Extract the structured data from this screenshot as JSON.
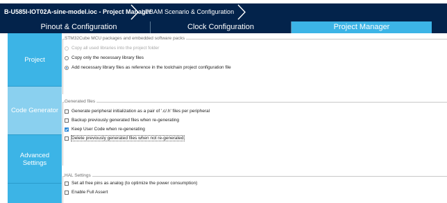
{
  "breadcrumb": {
    "file": "B-U585I-IOT02A-sine-model.ioc - Project Manager",
    "scenario": "LPBAM Scenario & Configuration"
  },
  "tabs": [
    {
      "label": "Pinout & Configuration",
      "active": false
    },
    {
      "label": "Clock Configuration",
      "active": false
    },
    {
      "label": "Project Manager",
      "active": true
    }
  ],
  "sidenav": {
    "items": [
      {
        "label": "Project",
        "active": false
      },
      {
        "label": "Code Generator",
        "active": true
      },
      {
        "label": "Advanced Settings",
        "active": false
      }
    ]
  },
  "groups": {
    "packs": {
      "title": "STM32Cube MCU packages and embedded software packs",
      "options": [
        {
          "label": "Copy all used libraries into the project folder",
          "selected": false,
          "disabled": true
        },
        {
          "label": "Copy only the necessary library files",
          "selected": false,
          "disabled": false
        },
        {
          "label": "Add necessary library files as reference in the toolchain project configuration file",
          "selected": true,
          "disabled": false
        }
      ]
    },
    "generated": {
      "title": "Generated files",
      "options": [
        {
          "label": "Generate peripheral initialization as a pair of '.c/.h' files per peripheral",
          "checked": false
        },
        {
          "label": "Backup previously generated files when re-generating",
          "checked": false
        },
        {
          "label": "Keep User Code when re-generating",
          "checked": true
        },
        {
          "label": "Delete previously generated files when not re-generated",
          "checked": false
        }
      ]
    },
    "hal": {
      "title": "HAL Settings",
      "options": [
        {
          "label": "Set all free pins as analog (to optimize the power consumption)",
          "checked": false
        },
        {
          "label": "Enable Full Assert",
          "checked": false
        }
      ]
    }
  },
  "colors": {
    "navy": "#03234b",
    "accent": "#3cb4e6",
    "active_nav": "#8ad0ef"
  }
}
